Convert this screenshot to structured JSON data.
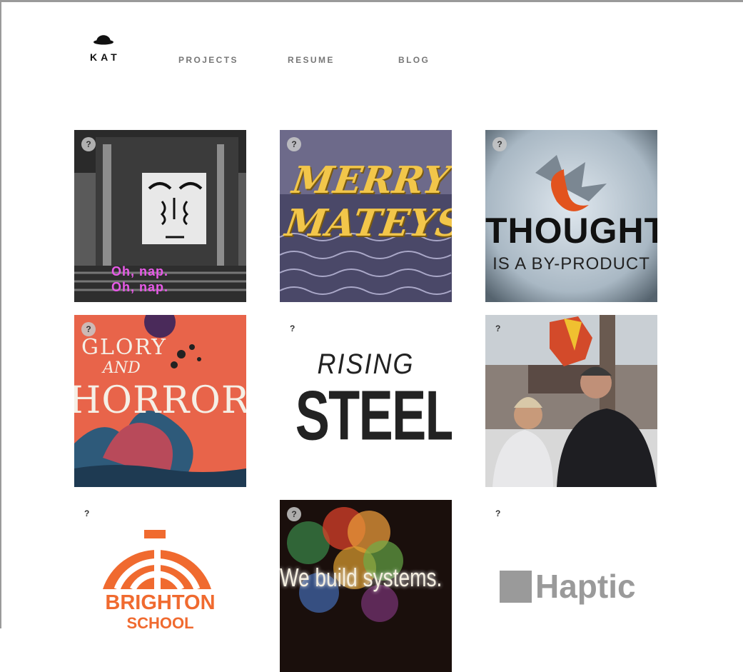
{
  "colors": {
    "page_bg": "#ffffff",
    "nav_text": "#777777",
    "brighton_orange": "#f06a2f",
    "haptic_gray": "#9a9a9a"
  },
  "header": {
    "logo": {
      "icon": "bowler-hat-icon",
      "text": "KAT"
    },
    "nav": [
      {
        "label": "PROJECTS"
      },
      {
        "label": "RESUME"
      },
      {
        "label": "BLOG"
      }
    ]
  },
  "badge_text": "?",
  "projects": [
    {
      "caption_line1": "Oh, nap.",
      "caption_line2": "Oh, nap."
    },
    {
      "title_line1": "MERRY",
      "title_line2": "MATEYS"
    },
    {
      "title": "THOUGHT",
      "subtitle": "IS A BY-PRODUCT"
    },
    {
      "line1": "GLORY",
      "line2": "AND",
      "line3": "HORROR"
    },
    {
      "title_line1": "RISING",
      "title_line2": "STEEL"
    },
    {},
    {
      "title_line1": "BRIGHTON",
      "title_line2": "SCHOOL"
    },
    {
      "caption": "We build systems."
    },
    {
      "title": "Haptic"
    }
  ]
}
